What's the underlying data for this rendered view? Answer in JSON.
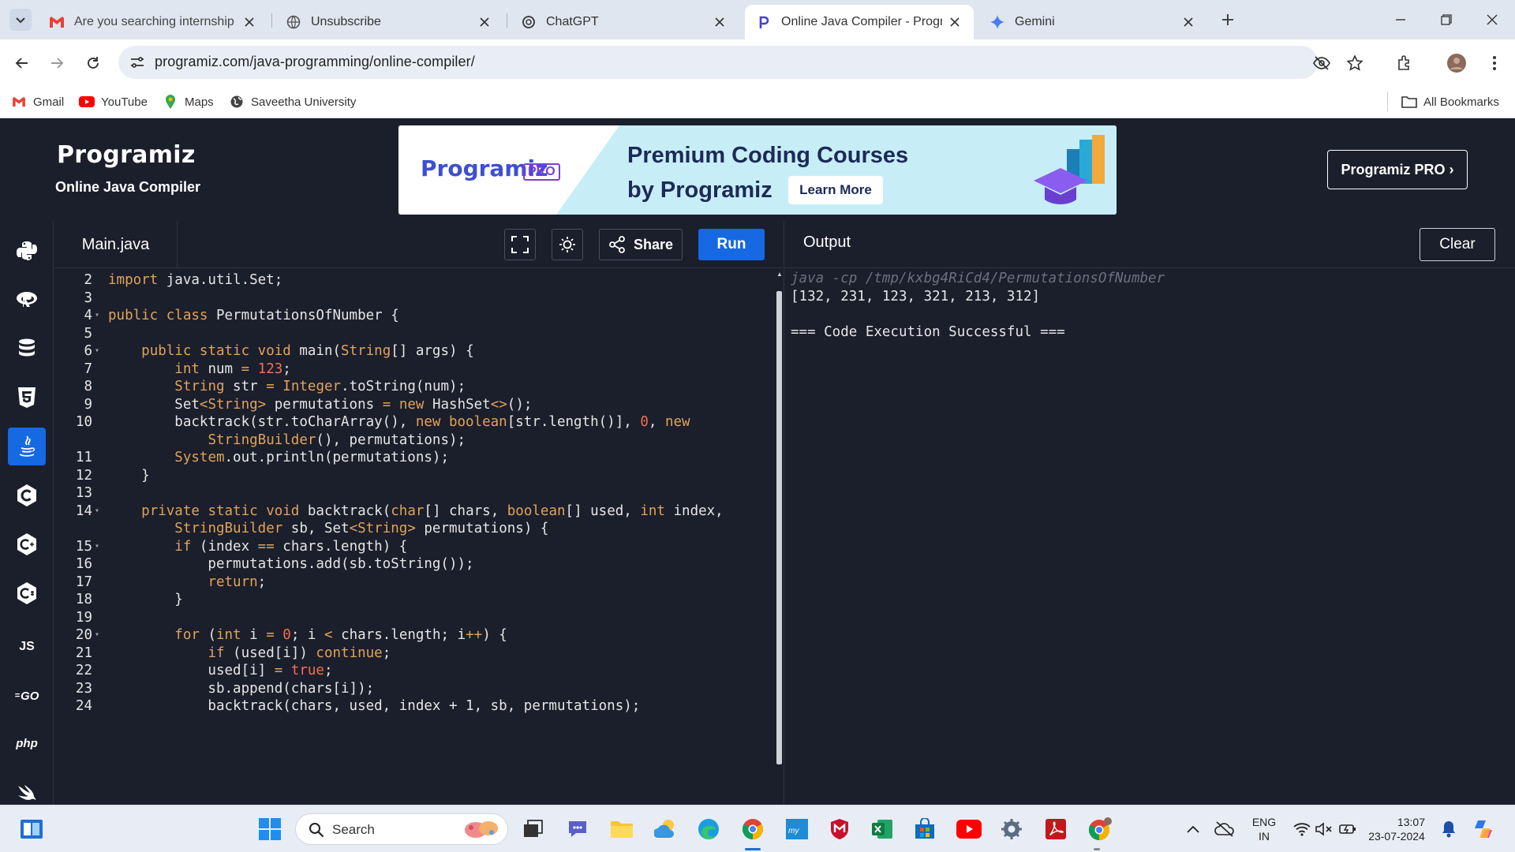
{
  "browser": {
    "tabs": [
      {
        "title": "Are you searching internship or",
        "icon": "gmail-icon"
      },
      {
        "title": "Unsubscribe",
        "icon": "globe-icon"
      },
      {
        "title": "ChatGPT",
        "icon": "chatgpt-icon"
      },
      {
        "title": "Online Java Compiler - Program",
        "icon": "programiz-icon",
        "active": true
      },
      {
        "title": "Gemini",
        "icon": "gemini-icon"
      }
    ],
    "url": "programiz.com/java-programming/online-compiler/",
    "bookmarks": [
      {
        "label": "Gmail",
        "icon": "gmail-icon"
      },
      {
        "label": "YouTube",
        "icon": "youtube-icon"
      },
      {
        "label": "Maps",
        "icon": "maps-icon"
      },
      {
        "label": "Saveetha University",
        "icon": "globe-icon"
      }
    ],
    "all_bookmarks": "All Bookmarks"
  },
  "site": {
    "logo": "Programiz",
    "subtitle": "Online Java Compiler",
    "banner": {
      "logo": "Programiz",
      "badge": "PRO",
      "headline1": "Premium Coding Courses",
      "headline2": "by Programiz",
      "cta": "Learn More"
    },
    "pro_button": "Programiz PRO ›"
  },
  "sidebar": {
    "languages": [
      {
        "name": "python",
        "icon": "python-icon"
      },
      {
        "name": "r",
        "icon": "r-icon"
      },
      {
        "name": "sql",
        "icon": "database-icon"
      },
      {
        "name": "html",
        "icon": "html5-icon"
      },
      {
        "name": "java",
        "icon": "java-icon",
        "active": true
      },
      {
        "name": "c",
        "icon": "c-icon"
      },
      {
        "name": "cpp",
        "icon": "cpp-icon"
      },
      {
        "name": "csharp",
        "icon": "csharp-icon"
      },
      {
        "name": "js",
        "label": "JS",
        "icon": "js-icon"
      },
      {
        "name": "go",
        "label": "GO",
        "icon": "go-icon"
      },
      {
        "name": "php",
        "label": "php",
        "icon": "php-icon"
      },
      {
        "name": "swift",
        "icon": "swift-icon"
      }
    ]
  },
  "editor": {
    "file_tab": "Main.java",
    "share_label": "Share",
    "run_label": "Run",
    "lines": [
      {
        "n": "2",
        "fold": false,
        "segs": [
          [
            "kw",
            "import"
          ],
          [
            "",
            " java.util.Set;"
          ]
        ]
      },
      {
        "n": "3",
        "fold": false,
        "segs": []
      },
      {
        "n": "4",
        "fold": true,
        "segs": [
          [
            "kw",
            "public class"
          ],
          [
            "",
            " PermutationsOfNumber {"
          ]
        ]
      },
      {
        "n": "5",
        "fold": false,
        "segs": []
      },
      {
        "n": "6",
        "fold": true,
        "segs": [
          [
            "",
            "    "
          ],
          [
            "kw",
            "public static void"
          ],
          [
            "",
            " main("
          ],
          [
            "ty",
            "String"
          ],
          [
            "",
            "[] args) {"
          ]
        ]
      },
      {
        "n": "7",
        "fold": false,
        "segs": [
          [
            "",
            "        "
          ],
          [
            "kw",
            "int"
          ],
          [
            "",
            " num "
          ],
          [
            "op",
            "="
          ],
          [
            "",
            " "
          ],
          [
            "num",
            "123"
          ],
          [
            "",
            ";"
          ]
        ]
      },
      {
        "n": "8",
        "fold": false,
        "segs": [
          [
            "",
            "        "
          ],
          [
            "ty",
            "String"
          ],
          [
            "",
            " str "
          ],
          [
            "op",
            "="
          ],
          [
            "",
            " "
          ],
          [
            "ty",
            "Integer"
          ],
          [
            "",
            ".toString(num);"
          ]
        ]
      },
      {
        "n": "9",
        "fold": false,
        "segs": [
          [
            "",
            "        Set"
          ],
          [
            "ty",
            "<String>"
          ],
          [
            "",
            " permutations "
          ],
          [
            "op",
            "="
          ],
          [
            "",
            " "
          ],
          [
            "kw",
            "new"
          ],
          [
            "",
            " HashSet"
          ],
          [
            "op",
            "<>"
          ],
          [
            "",
            "();"
          ]
        ]
      },
      {
        "n": "10",
        "fold": false,
        "segs": [
          [
            "",
            "        backtrack(str.toCharArray(), "
          ],
          [
            "kw",
            "new boolean"
          ],
          [
            "",
            "[str.length()], "
          ],
          [
            "num",
            "0"
          ],
          [
            "",
            ", "
          ],
          [
            "kw",
            "new"
          ]
        ]
      },
      {
        "n": "",
        "fold": false,
        "segs": [
          [
            "",
            "            "
          ],
          [
            "ty",
            "StringBuilder"
          ],
          [
            "",
            "(), permutations);"
          ]
        ]
      },
      {
        "n": "11",
        "fold": false,
        "segs": [
          [
            "",
            "        "
          ],
          [
            "ty",
            "System"
          ],
          [
            "",
            ".out.println(permutations);"
          ]
        ]
      },
      {
        "n": "12",
        "fold": false,
        "segs": [
          [
            "",
            "    }"
          ]
        ]
      },
      {
        "n": "13",
        "fold": false,
        "segs": []
      },
      {
        "n": "14",
        "fold": true,
        "segs": [
          [
            "",
            "    "
          ],
          [
            "kw",
            "private static void"
          ],
          [
            "",
            " backtrack("
          ],
          [
            "kw",
            "char"
          ],
          [
            "",
            "[] chars, "
          ],
          [
            "kw",
            "boolean"
          ],
          [
            "",
            "[] used, "
          ],
          [
            "kw",
            "int"
          ],
          [
            "",
            " index,"
          ]
        ]
      },
      {
        "n": "",
        "fold": false,
        "segs": [
          [
            "",
            "        "
          ],
          [
            "ty",
            "StringBuilder"
          ],
          [
            "",
            " sb, Set"
          ],
          [
            "ty",
            "<String>"
          ],
          [
            "",
            " permutations) {"
          ]
        ]
      },
      {
        "n": "15",
        "fold": true,
        "segs": [
          [
            "",
            "        "
          ],
          [
            "kw",
            "if"
          ],
          [
            "",
            " (index "
          ],
          [
            "op",
            "=="
          ],
          [
            "",
            " chars.length) {"
          ]
        ]
      },
      {
        "n": "16",
        "fold": false,
        "segs": [
          [
            "",
            "            permutations.add(sb.toString());"
          ]
        ]
      },
      {
        "n": "17",
        "fold": false,
        "segs": [
          [
            "",
            "            "
          ],
          [
            "kw",
            "return"
          ],
          [
            "",
            ";"
          ]
        ]
      },
      {
        "n": "18",
        "fold": false,
        "segs": [
          [
            "",
            "        }"
          ]
        ]
      },
      {
        "n": "19",
        "fold": false,
        "segs": []
      },
      {
        "n": "20",
        "fold": true,
        "segs": [
          [
            "",
            "        "
          ],
          [
            "kw",
            "for"
          ],
          [
            "",
            " ("
          ],
          [
            "kw",
            "int"
          ],
          [
            "",
            " i "
          ],
          [
            "op",
            "="
          ],
          [
            "",
            " "
          ],
          [
            "num",
            "0"
          ],
          [
            "",
            "; i "
          ],
          [
            "op",
            "<"
          ],
          [
            "",
            " chars.length; i"
          ],
          [
            "op",
            "++"
          ],
          [
            "",
            ") {"
          ]
        ]
      },
      {
        "n": "21",
        "fold": false,
        "segs": [
          [
            "",
            "            "
          ],
          [
            "kw",
            "if"
          ],
          [
            "",
            " (used[i]) "
          ],
          [
            "kw",
            "continue"
          ],
          [
            "",
            ";"
          ]
        ]
      },
      {
        "n": "22",
        "fold": false,
        "segs": [
          [
            "",
            "            used[i] "
          ],
          [
            "op",
            "="
          ],
          [
            "",
            " "
          ],
          [
            "num",
            "true"
          ],
          [
            "",
            ";"
          ]
        ]
      },
      {
        "n": "23",
        "fold": false,
        "segs": [
          [
            "",
            "            sb.append(chars[i]);"
          ]
        ]
      },
      {
        "n": "24",
        "fold": false,
        "segs": [
          [
            "",
            "            backtrack(chars, used, index + 1, sb, permutations);"
          ]
        ]
      }
    ]
  },
  "output": {
    "title": "Output",
    "clear_label": "Clear",
    "lines": [
      {
        "text": "java -cp /tmp/kxbg4RiCd4/PermutationsOfNumber",
        "style": "cmd"
      },
      {
        "text": "[132, 231, 123, 321, 213, 312]",
        "style": ""
      },
      {
        "text": "",
        "style": ""
      },
      {
        "text": "=== Code Execution Successful ===",
        "style": ""
      }
    ]
  },
  "taskbar": {
    "search_label": "Search",
    "lang_top": "ENG",
    "lang_bottom": "IN",
    "time": "13:07",
    "date": "23-07-2024"
  },
  "colors": {
    "accent": "#1668e3",
    "background": "#1b1e2b",
    "keyword": "#e0a35a",
    "number": "#f07050"
  }
}
